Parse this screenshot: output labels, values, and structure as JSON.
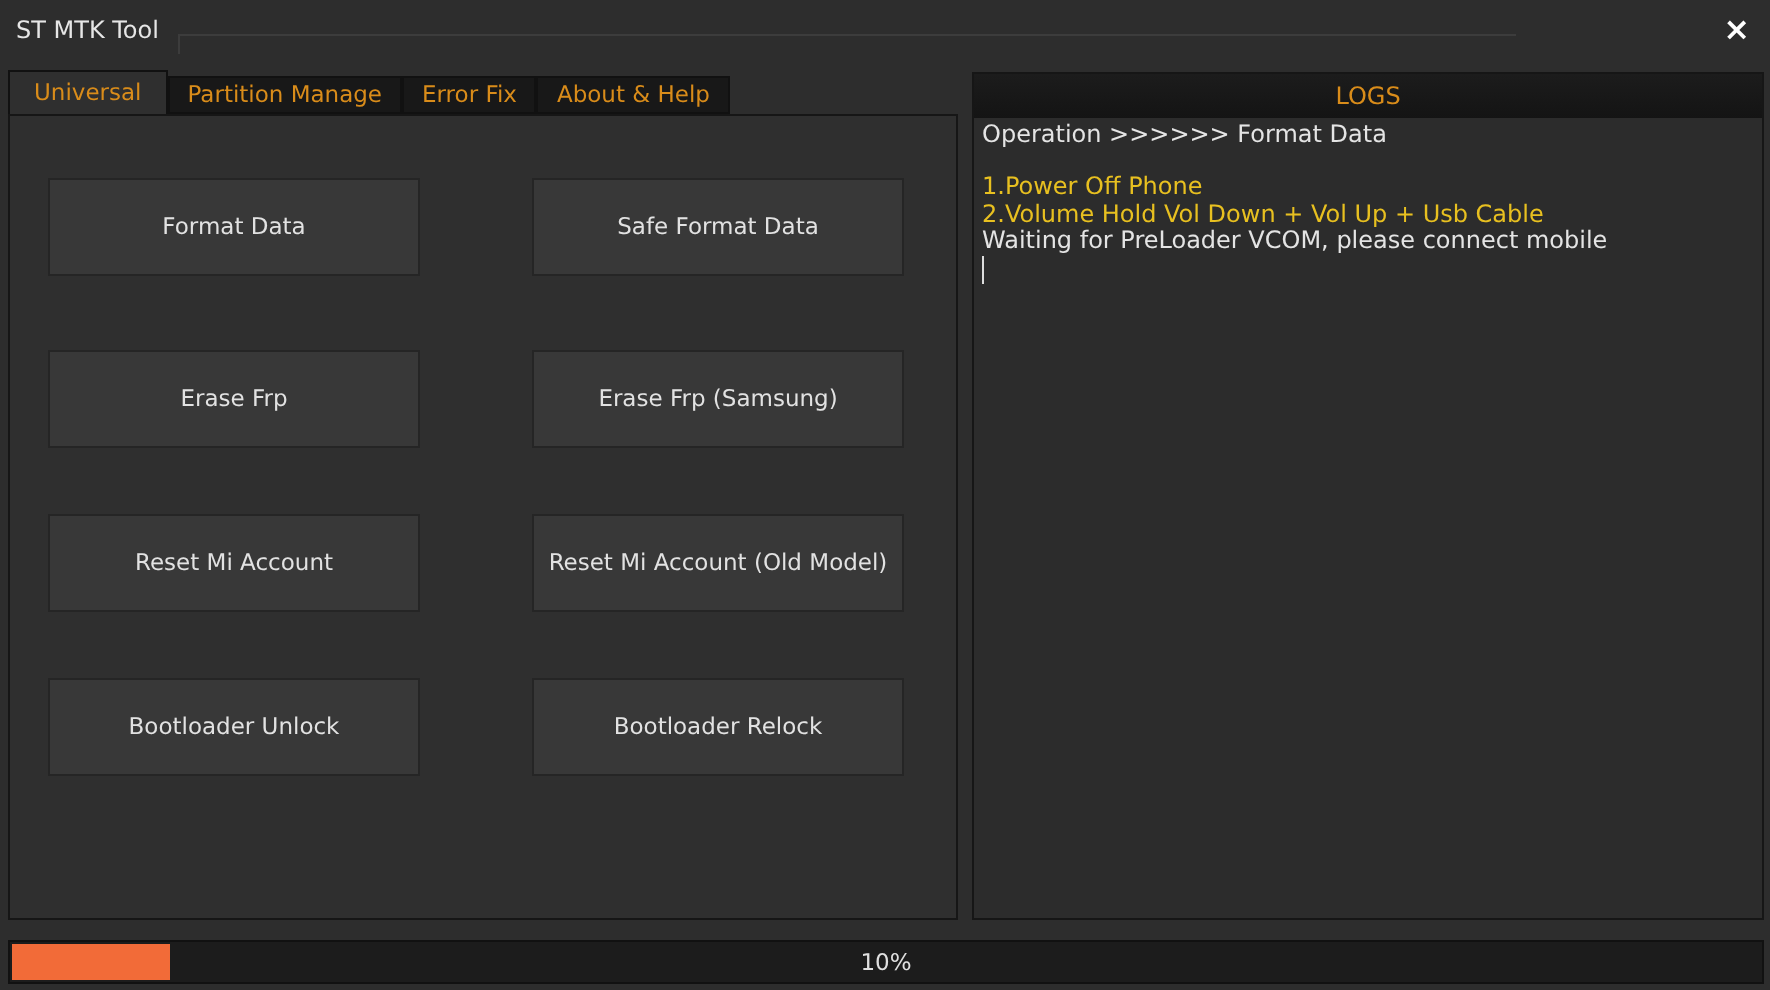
{
  "window": {
    "title": "ST MTK Tool",
    "close": "×"
  },
  "tabs": [
    {
      "label": "Universal",
      "selected": true
    },
    {
      "label": "Partition Manage",
      "selected": false
    },
    {
      "label": "Error Fix",
      "selected": false
    },
    {
      "label": "About & Help",
      "selected": false
    }
  ],
  "buttons": [
    "Format Data",
    "Safe Format Data",
    "Erase Frp",
    "Erase Frp (Samsung)",
    "Reset Mi Account",
    "Reset Mi Account (Old Model)",
    "Bootloader Unlock",
    "Bootloader Relock"
  ],
  "logs": {
    "title": "LOGS",
    "lines": [
      {
        "kind": "info",
        "text": "Operation >>>>>> Format Data"
      },
      {
        "kind": "note",
        "text": "1.Power Off Phone"
      },
      {
        "kind": "note",
        "text": "2.Volume Hold Vol Down + Vol Up + Usb Cable"
      },
      {
        "kind": "info",
        "text": "Waiting for PreLoader VCOM, please connect mobile"
      }
    ]
  },
  "progress": {
    "level": 0.09,
    "reading": "10%"
  }
}
